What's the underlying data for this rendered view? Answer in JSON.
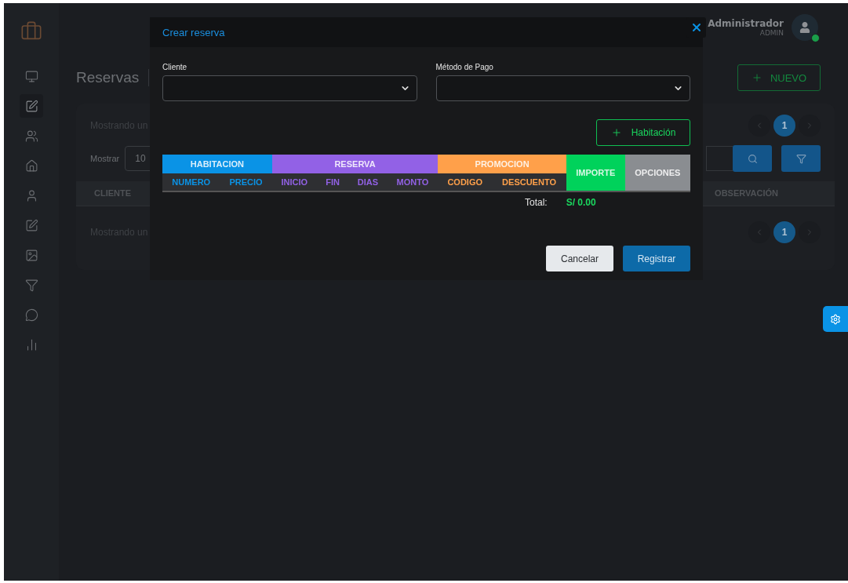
{
  "sidebar": {
    "items": [
      {
        "selected": false
      },
      {
        "selected": true
      },
      {
        "selected": false
      },
      {
        "selected": false
      },
      {
        "selected": false
      },
      {
        "selected": false
      },
      {
        "selected": false
      },
      {
        "selected": false
      },
      {
        "selected": false
      },
      {
        "selected": false
      }
    ]
  },
  "header": {
    "user_name": "Administrador",
    "user_role": "ADMIN",
    "online": true
  },
  "page": {
    "title": "Reservas",
    "new_button": "NUEVO"
  },
  "card": {
    "info_top": "Mostrando un",
    "info_bottom": "Mostrando un",
    "pagination_top": [
      {
        "label": "1",
        "selected": true
      }
    ],
    "pagination_bottom": [
      {
        "label": "1",
        "selected": true
      }
    ],
    "show_label": "Mostrar",
    "show_value": "10",
    "columns": [
      "CLIENTE",
      "OBSERVACIÓN"
    ]
  },
  "modal": {
    "title": "Crear reserva",
    "fields": [
      {
        "label": "Cliente"
      },
      {
        "label": "Método de Pago"
      }
    ],
    "add_room_button": "Habitación",
    "table": {
      "headers": [
        {
          "kind": "group",
          "label": "HABITACION",
          "color": "#0a93e6",
          "columns": [
            "NUMERO",
            "PRECIO"
          ]
        },
        {
          "kind": "group",
          "label": "RESERVA",
          "color": "#9261e6",
          "columns": [
            "INICIO",
            "FIN",
            "DIAS",
            "MONTO"
          ]
        },
        {
          "kind": "group",
          "label": "PROMOCION",
          "color": "#ffa04a",
          "columns": [
            "CODIGO",
            "DESCUENTO"
          ]
        },
        {
          "kind": "single",
          "label": "IMPORTE",
          "color": "#00d25b"
        },
        {
          "kind": "single",
          "label": "OPCIONES",
          "color": "#8a8d91"
        }
      ]
    },
    "total_label": "Total:",
    "total_value": "S/ 0.00",
    "buttons": [
      {
        "label": "Cancelar",
        "kind": "secondary"
      },
      {
        "label": "Registrar",
        "kind": "primary"
      }
    ]
  }
}
